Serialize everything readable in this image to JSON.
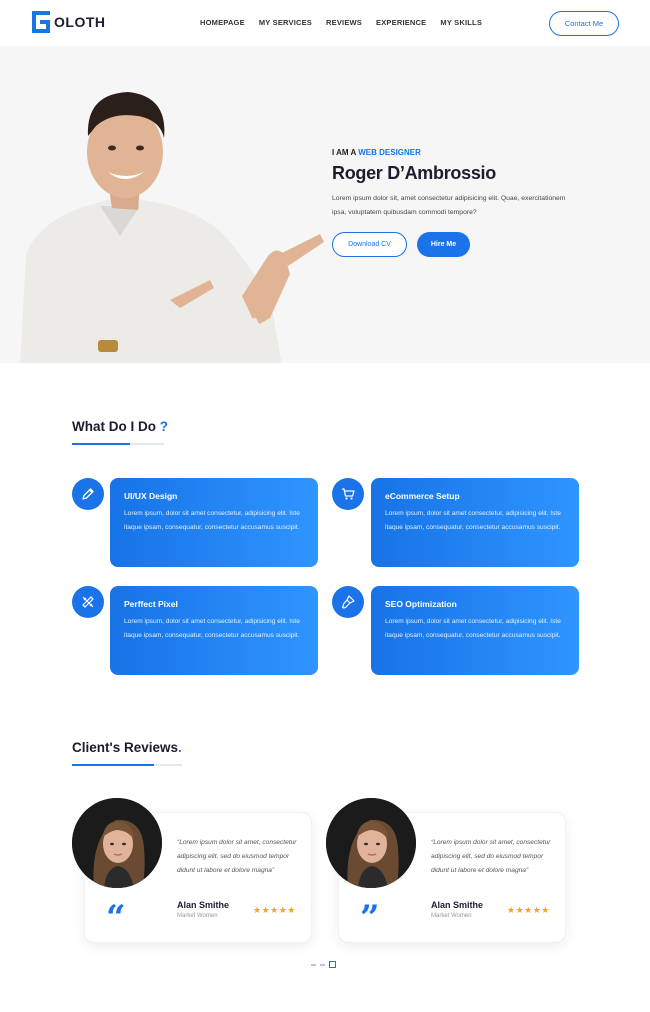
{
  "brand": {
    "name": "OLOTH",
    "accent": "#1a73e8"
  },
  "nav": [
    "HOMEPAGE",
    "MY SERVICES",
    "REVIEWS",
    "EXPERIENCE",
    "MY SKILLS"
  ],
  "header": {
    "contact_label": "Contact Me"
  },
  "hero": {
    "intro_prefix": "I AM A",
    "intro_role": "WEB DESIGNER",
    "name": "Roger D’Ambrossio",
    "description": "Lorem ipsum dolor sit, amet consectetur adipisicing elit. Quae, exercitationem ipsa, voluptatem quibusdam commodi tempore?",
    "download_label": "Download CV",
    "hire_label": "Hire Me"
  },
  "services": {
    "title": "What Do I Do",
    "title_mark": "?",
    "items": [
      {
        "title": "UI/UX Design",
        "text": "Lorem ipsum, dolor sit amet consectetur, adipisicing elit. Iste itaque ipsam, consequatur, consectetur accusamus suscipit.",
        "icon": "pencil-icon"
      },
      {
        "title": "eCommerce Setup",
        "text": "Lorem ipsum, dolor sit amet consectetur, adipisicing elit. Iste itaque ipsam, consequatur, consectetur accusamus suscipit.",
        "icon": "cart-icon"
      },
      {
        "title": "Perffect Pixel",
        "text": "Lorem ipsum, dolor sit amet consectetur, adipisicing elit. Iste itaque ipsam, consequatur, consectetur accusamus suscipit.",
        "icon": "ruler-pencil-icon"
      },
      {
        "title": "SEO Optimization",
        "text": "Lorem ipsum, dolor sit amet consectetur, adipisicing elit. Iste itaque ipsam, consequatur, consectetur accusamus suscipit.",
        "icon": "brush-icon"
      }
    ]
  },
  "reviews": {
    "title": "Client's Reviews",
    "title_mark": ".",
    "items": [
      {
        "quote": "“Lorem ipsum dolor sit amet, consectetur adipiscing elit, sed do eiusmod tempor didunt ut labore et dolore magna”",
        "name": "Alan Smithe",
        "role": "Market Women",
        "stars": "★★★★★",
        "rating": 5
      },
      {
        "quote": "“Lorem ipsum dolor sit amet, consectetur adipiscing elit, sed do eiusmod tempor didunt ut labore et dolore magna”",
        "name": "Alan Smithe",
        "role": "Market Women",
        "stars": "★★★★★",
        "rating": 5
      }
    ],
    "pager": {
      "pages": 3,
      "active": 3
    }
  }
}
